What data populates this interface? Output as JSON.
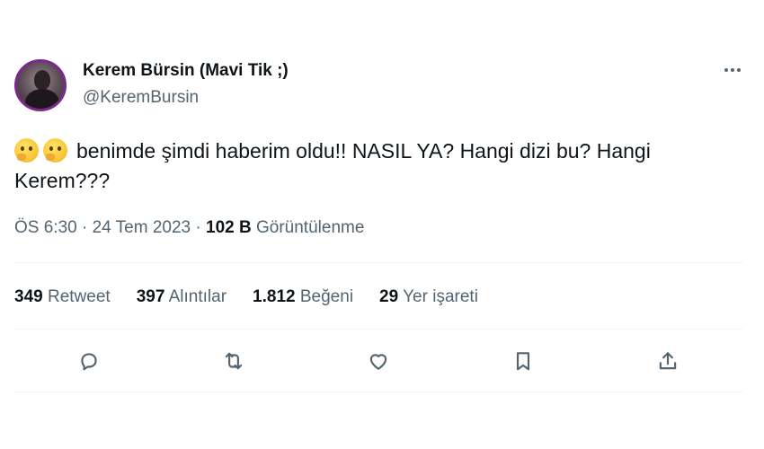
{
  "user": {
    "display_name": "Kerem Bürsin (Mavi Tik ;)",
    "handle": "@KeremBursin"
  },
  "tweet": {
    "emojis": [
      "thinking-face-icon",
      "thinking-face-icon"
    ],
    "text": "benimde şimdi haberim oldu!! NASIL YA? Hangi dizi bu? Hangi Kerem???",
    "time": "ÖS 6:30",
    "date": "24 Tem 2023",
    "separator": "·",
    "views_count": "102 B",
    "views_label": "Görüntülenme"
  },
  "stats": [
    {
      "count": "349",
      "label": "Retweet"
    },
    {
      "count": "397",
      "label": "Alıntılar"
    },
    {
      "count": "1.812",
      "label": "Beğeni"
    },
    {
      "count": "29",
      "label": "Yer işareti"
    }
  ],
  "actions": [
    "reply-icon",
    "retweet-icon",
    "like-icon",
    "bookmark-icon",
    "share-icon"
  ],
  "colors": {
    "text_primary": "#0f1419",
    "text_secondary": "#536471",
    "divider": "#eff3f4",
    "avatar_ring": "#7a2a8a"
  }
}
